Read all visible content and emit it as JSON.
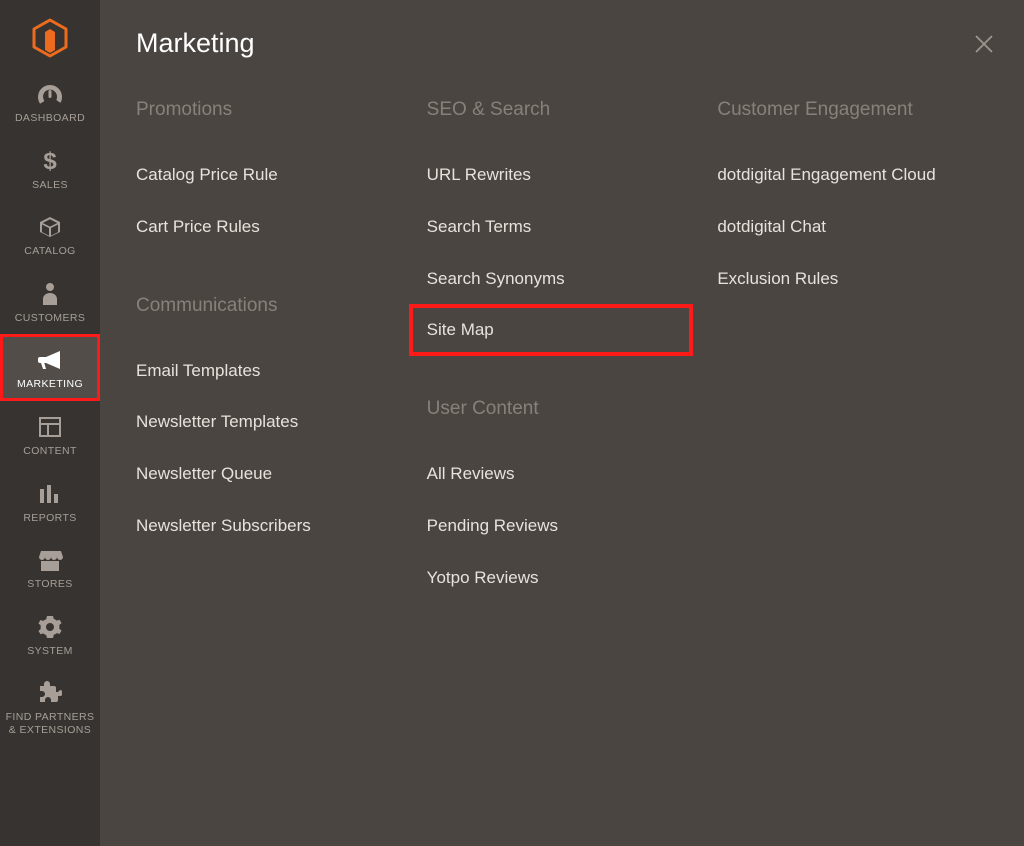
{
  "panel": {
    "title": "Marketing"
  },
  "sidebar": {
    "items": [
      {
        "id": "dashboard",
        "label": "DASHBOARD"
      },
      {
        "id": "sales",
        "label": "SALES"
      },
      {
        "id": "catalog",
        "label": "CATALOG"
      },
      {
        "id": "customers",
        "label": "CUSTOMERS"
      },
      {
        "id": "marketing",
        "label": "MARKETING",
        "active": true,
        "highlight": true
      },
      {
        "id": "content",
        "label": "CONTENT"
      },
      {
        "id": "reports",
        "label": "REPORTS"
      },
      {
        "id": "stores",
        "label": "STORES"
      },
      {
        "id": "system",
        "label": "SYSTEM"
      },
      {
        "id": "partners",
        "label": "FIND PARTNERS & EXTENSIONS"
      }
    ]
  },
  "columns": [
    {
      "sections": [
        {
          "heading": "Promotions",
          "links": [
            {
              "label": "Catalog Price Rule"
            },
            {
              "label": "Cart Price Rules"
            }
          ]
        },
        {
          "heading": "Communications",
          "links": [
            {
              "label": "Email Templates"
            },
            {
              "label": "Newsletter Templates"
            },
            {
              "label": "Newsletter Queue"
            },
            {
              "label": "Newsletter Subscribers"
            }
          ]
        }
      ]
    },
    {
      "sections": [
        {
          "heading": "SEO & Search",
          "links": [
            {
              "label": "URL Rewrites"
            },
            {
              "label": "Search Terms"
            },
            {
              "label": "Search Synonyms"
            },
            {
              "label": "Site Map",
              "boxed": true
            }
          ]
        },
        {
          "heading": "User Content",
          "links": [
            {
              "label": "All Reviews"
            },
            {
              "label": "Pending Reviews"
            },
            {
              "label": "Yotpo Reviews"
            }
          ]
        }
      ]
    },
    {
      "sections": [
        {
          "heading": "Customer Engagement",
          "links": [
            {
              "label": "dotdigital Engagement Cloud"
            },
            {
              "label": "dotdigital Chat"
            },
            {
              "label": "Exclusion Rules"
            }
          ]
        }
      ]
    }
  ]
}
